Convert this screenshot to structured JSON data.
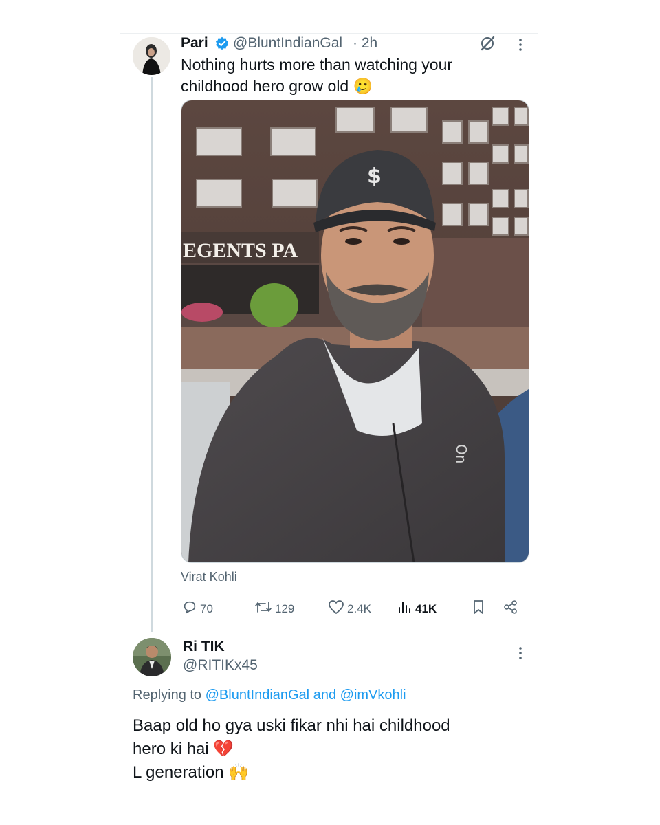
{
  "tweet": {
    "author_name": "Pari",
    "handle": "@BluntIndianGal",
    "time": "· 2h",
    "text_line1": "Nothing hurts more than watching your",
    "text_line2": "childhood hero grow old",
    "emoji": "🥲",
    "photo_sign": "EGENTS PA",
    "cap_logo": "$",
    "hoodie_logo": "On",
    "media_tag": "Virat Kohli",
    "metrics": {
      "replies": "70",
      "retweets": "129",
      "likes": "2.4K",
      "views": "41K"
    }
  },
  "reply": {
    "author_name": "Ri TIK",
    "handle": "@RITIKx45",
    "replying_prefix": "Replying to",
    "replying_user1": "@BluntIndianGal",
    "replying_and": "and",
    "replying_user2": "@imVkohli",
    "line1": "Baap old ho gya uski fikar nhi hai childhood",
    "line2": "hero ki hai 💔",
    "line3": "L generation 🙌"
  },
  "colors": {
    "link": "#1d9bf0",
    "muted": "#536471",
    "verified": "#1d9bf0"
  },
  "icons": [
    "verified-badge-icon",
    "grok-icon",
    "more-icon",
    "reply-icon",
    "retweet-icon",
    "like-icon",
    "views-icon",
    "bookmark-icon",
    "share-icon"
  ]
}
